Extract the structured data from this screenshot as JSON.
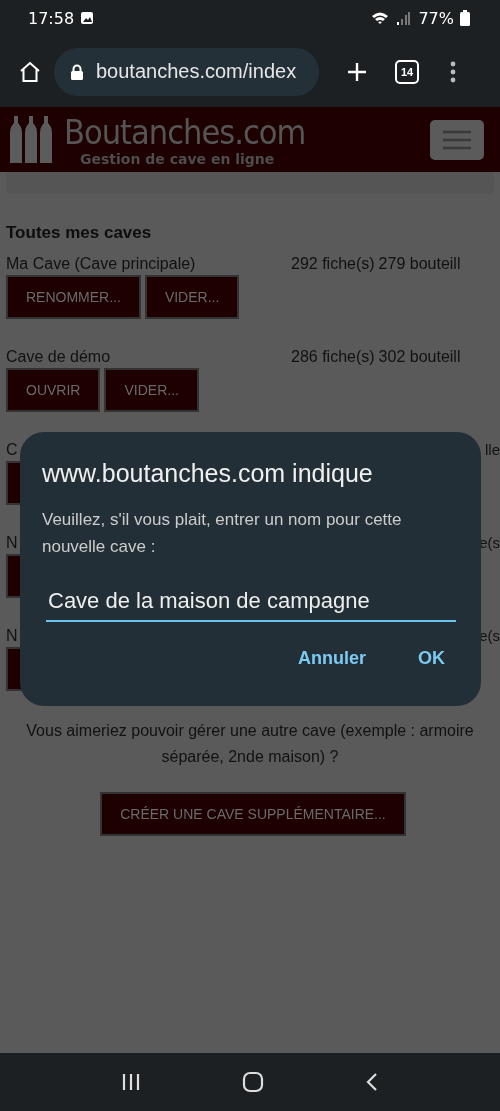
{
  "status_bar": {
    "time": "17:58",
    "battery": "77%"
  },
  "browser": {
    "url": "boutanches.com/index",
    "tab_count": "14"
  },
  "site_header": {
    "logo_text": "Boutanches.com",
    "tagline": "Gestion de cave en ligne"
  },
  "section_title": "Toutes mes caves",
  "cellars": [
    {
      "name": "Ma Cave (Cave principale)",
      "count": "292 fiche(s)",
      "bottles": "279 bouteill",
      "buttons": [
        "RENOMMER...",
        "VIDER..."
      ]
    },
    {
      "name": "Cave de démo",
      "count": "286 fiche(s)",
      "bottles": "302 bouteill",
      "buttons": [
        "OUVRIR",
        "VIDER..."
      ]
    },
    {
      "name": "C",
      "count": "lle"
    },
    {
      "name": "N",
      "count": "e(s"
    },
    {
      "name": "N",
      "count": "e(s"
    }
  ],
  "prompt": "Vous aimeriez pouvoir gérer une autre cave (exemple : armoire séparée, 2nde maison) ?",
  "create_button": "CRÉER UNE CAVE SUPPLÉMENTAIRE...",
  "dialog": {
    "title": "www.boutanches.com indique",
    "message": "Veuillez, s'il vous plait, entrer un nom pour cette nouvelle cave :",
    "value": "Cave de la maison de campagne",
    "buttons": [
      "Annuler",
      "OK"
    ]
  }
}
